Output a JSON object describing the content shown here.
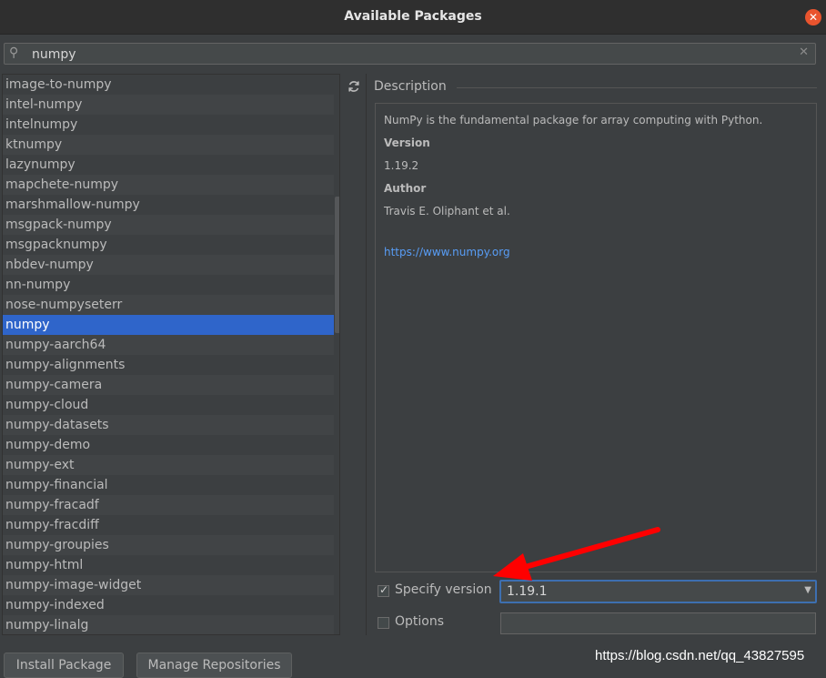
{
  "window": {
    "title": "Available Packages"
  },
  "search": {
    "value": "numpy",
    "search_icon": "search-icon",
    "clear_icon": "clear-icon"
  },
  "packages": [
    "image-to-numpy",
    "intel-numpy",
    "intelnumpy",
    "ktnumpy",
    "lazynumpy",
    "mapchete-numpy",
    "marshmallow-numpy",
    "msgpack-numpy",
    "msgpacknumpy",
    "nbdev-numpy",
    "nn-numpy",
    "nose-numpyseterr",
    "numpy",
    "numpy-aarch64",
    "numpy-alignments",
    "numpy-camera",
    "numpy-cloud",
    "numpy-datasets",
    "numpy-demo",
    "numpy-ext",
    "numpy-financial",
    "numpy-fracadf",
    "numpy-fracdiff",
    "numpy-groupies",
    "numpy-html",
    "numpy-image-widget",
    "numpy-indexed",
    "numpy-linalg"
  ],
  "selected_package": "numpy",
  "description": {
    "header": "Description",
    "summary": "NumPy is the fundamental package for array computing with Python.",
    "version_label": "Version",
    "version_value": "1.19.2",
    "author_label": "Author",
    "author_value": "Travis E. Oliphant et al.",
    "link": "https://www.numpy.org"
  },
  "specify_version": {
    "label": "Specify version",
    "checked": true,
    "value": "1.19.1"
  },
  "options": {
    "label": "Options",
    "checked": false,
    "value": ""
  },
  "buttons": {
    "install": "Install Package",
    "manage": "Manage Repositories"
  },
  "watermark": "https://blog.csdn.net/qq_43827595",
  "colors": {
    "selection": "#2f65ca",
    "accent_border": "#3d6fb0",
    "link": "#589df6",
    "close": "#e9542e",
    "annotation_arrow": "#ff0000"
  }
}
